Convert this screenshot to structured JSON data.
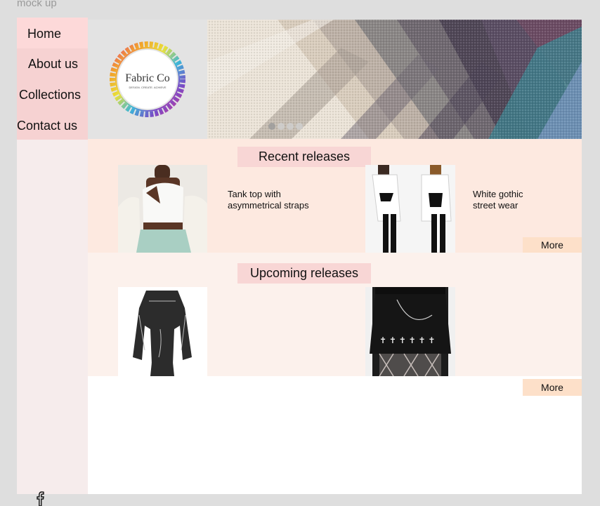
{
  "frame_label": "mock up",
  "nav": {
    "home": "Home",
    "about": "About us",
    "collections": "Collections",
    "contact": "Contact us"
  },
  "logo": {
    "name": "Fabric Co",
    "tagline": "DESIGN. CREATE. ACHIEVE"
  },
  "carousel": {
    "slides": 4,
    "active_index": 0
  },
  "recent": {
    "title": "Recent releases",
    "items": [
      {
        "caption_line1": "Tank top with",
        "caption_line2": "asymmetrical straps"
      },
      {
        "caption_line1": "White gothic",
        "caption_line2": "street wear"
      }
    ],
    "more_label": "More"
  },
  "upcoming": {
    "title": "Upcoming releases",
    "more_label": "More"
  },
  "footer": {
    "social_icon": "facebook-icon"
  },
  "colors": {
    "nav_bg": "#f6d2d2",
    "nav_active": "#fdd9d9",
    "recent_bg": "#fde9e0",
    "upcoming_bg": "#fcf1ec",
    "title_pill": "#f8d6d5",
    "more_btn": "#fde0c9"
  }
}
